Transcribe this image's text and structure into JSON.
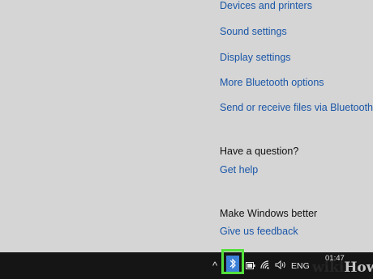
{
  "related_links": [
    "Devices and printers",
    "Sound settings",
    "Display settings",
    "More Bluetooth options",
    "Send or receive files via Bluetooth"
  ],
  "question_section": {
    "heading": "Have a question?",
    "link": "Get help"
  },
  "feedback_section": {
    "heading": "Make Windows better",
    "link": "Give us feedback"
  },
  "taskbar": {
    "tray_chevron": "^",
    "language": "ENG",
    "time": "01:47",
    "icons": [
      "chevron-up-icon",
      "bluetooth-icon",
      "battery-icon",
      "wifi-icon",
      "volume-icon"
    ],
    "highlight_color": "#52e03a",
    "bluetooth_color": "#3b7fd6"
  },
  "watermark": {
    "text_dark": "wiki",
    "text_light": "How"
  }
}
